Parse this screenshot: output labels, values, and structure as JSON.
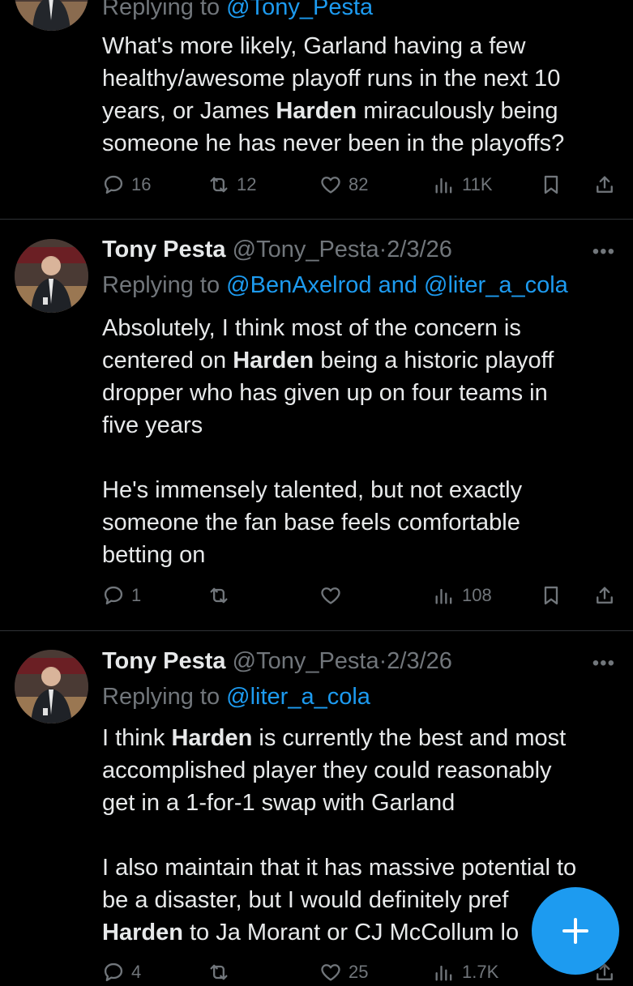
{
  "tweet1": {
    "replying_prefix": "Replying to ",
    "replying_to": "@Tony_Pesta",
    "lines": [
      "What's more likely, Garland having a few",
      "healthy/awesome playoff runs in the next 10",
      "years, or James ",
      "Harden",
      " miraculously being",
      "someone he has never been in the playoffs?"
    ],
    "replies": "16",
    "retweets": "12",
    "likes": "82",
    "views": "11K"
  },
  "tweet2": {
    "name": "Tony Pesta",
    "handle": "@Tony_Pesta",
    "sep": "·",
    "date": "2/3/26",
    "more": "•••",
    "replying_prefix": "Replying to ",
    "mention1": "@BenAxelrod",
    "and": " and ",
    "mention2": "@liter_a_cola",
    "p1_l1": "Absolutely, I think most of the concern is",
    "p1_l2a": "centered on ",
    "p1_l2b": "Harden",
    "p1_l2c": " being a historic playoff",
    "p1_l3": "dropper who has given up on four teams in",
    "p1_l4": "five years",
    "p2_l1": "He's immensely talented, but not exactly",
    "p2_l2": "someone the fan base feels comfortable",
    "p2_l3": "betting on",
    "replies": "1",
    "views": "108"
  },
  "tweet3": {
    "name": "Tony Pesta",
    "handle": "@Tony_Pesta",
    "sep": "·",
    "date": "2/3/26",
    "more": "•••",
    "replying_prefix": "Replying to ",
    "mention1": "@liter_a_cola",
    "p1_l1a": "I think ",
    "p1_l1b": "Harden",
    "p1_l1c": " is currently the best and most",
    "p1_l2": "accomplished player they could reasonably",
    "p1_l3": "get in a 1-for-1 swap with Garland",
    "p2_l1": "I also maintain that it has massive potential to",
    "p2_l2": "be a disaster, but I would definitely pref",
    "p2_l3a": "Harden",
    "p2_l3b": " to Ja Morant or CJ McCollum lo",
    "replies": "4",
    "likes": "25",
    "views": "1.7K"
  },
  "colors": {
    "accent": "#1d9bf0",
    "muted": "#71767b",
    "text": "#e7e9ea",
    "background": "#000000"
  }
}
